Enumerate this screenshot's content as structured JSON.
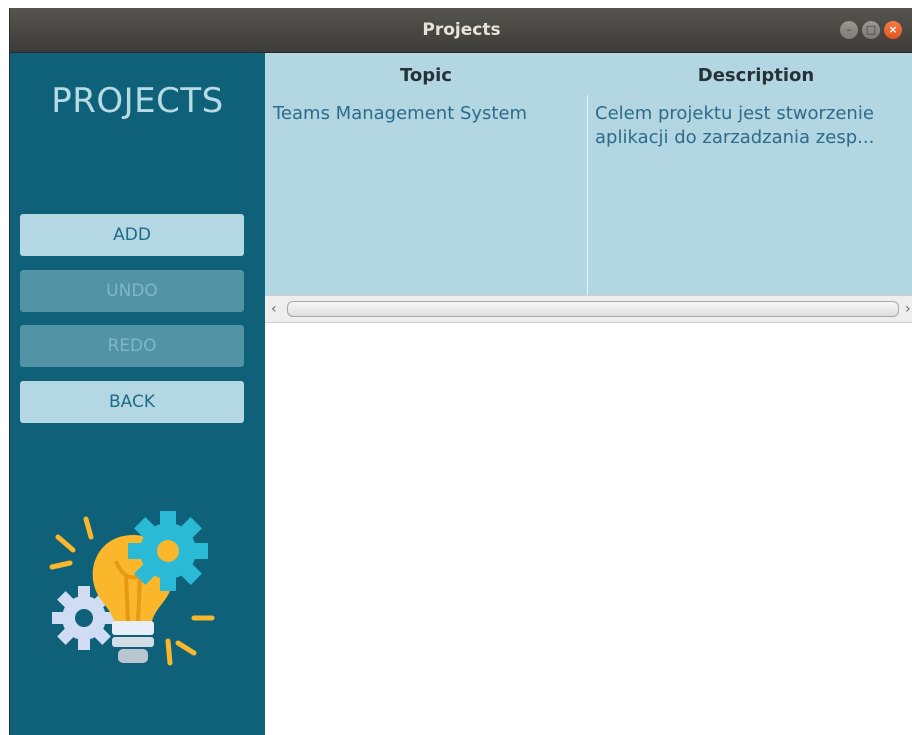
{
  "window": {
    "title": "Projects",
    "controls": {
      "minimize": "–",
      "maximize": "□",
      "close": "×"
    }
  },
  "sidebar": {
    "title": "PROJECTS",
    "buttons": [
      {
        "label": "ADD",
        "enabled": true
      },
      {
        "label": "UNDO",
        "enabled": false
      },
      {
        "label": "REDO",
        "enabled": false
      },
      {
        "label": "BACK",
        "enabled": true
      }
    ],
    "logo_icon": "lightbulb-gears-icon"
  },
  "table": {
    "columns": [
      "Topic",
      "Description"
    ],
    "rows": [
      {
        "topic": "Teams Management System",
        "description_line1": "Celem projektu jest stworzenie",
        "description_line2": "aplikacji do zarzadzania zesp..."
      }
    ]
  },
  "colors": {
    "sidebar_bg": "#0e6179",
    "button_bg": "#b3d8e4",
    "table_bg": "#b2d7e2",
    "accent_gear": "#2bbad6",
    "bulb_yellow": "#fbb72b"
  }
}
